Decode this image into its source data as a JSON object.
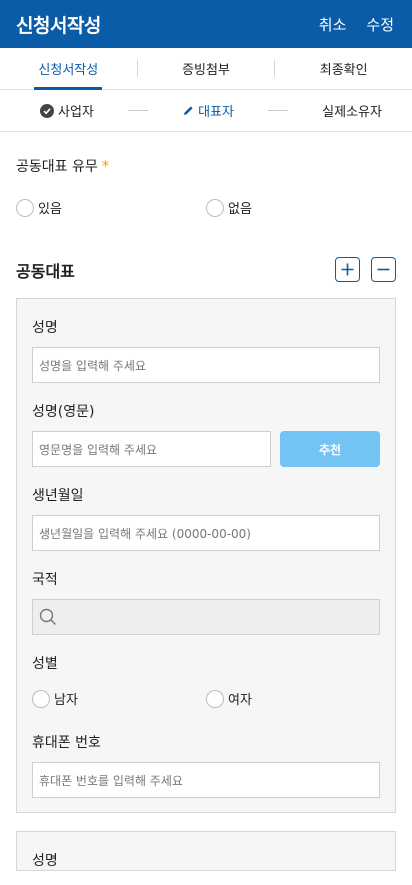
{
  "header": {
    "title": "신청서작성",
    "cancel": "취소",
    "edit": "수정"
  },
  "tabs": [
    {
      "label": "신청서작성",
      "active": true
    },
    {
      "label": "증빙첨부",
      "active": false
    },
    {
      "label": "최종확인",
      "active": false
    }
  ],
  "steps": [
    {
      "label": "사업자",
      "icon": "check-circle-icon"
    },
    {
      "label": "대표자",
      "icon": "pencil-icon"
    },
    {
      "label": "실제소유자",
      "icon": ""
    }
  ],
  "joint": {
    "question": "공동대표 유무",
    "required_mark": "*",
    "options": [
      "있음",
      "없음"
    ]
  },
  "co_rep": {
    "title": "공동대표",
    "name_label": "성명",
    "name_placeholder": "성명을 입력해 주세요",
    "eng_label": "성명(영문)",
    "eng_placeholder": "영문명을 입력해 주세요",
    "recommend": "추천",
    "birth_label": "생년월일",
    "birth_placeholder": "생년월일을 입력해 주세요 (0000-00-00)",
    "nation_label": "국적",
    "gender_label": "성별",
    "gender_options": [
      "남자",
      "여자"
    ],
    "phone_label": "휴대폰 번호",
    "phone_placeholder": "휴대폰 번호를 입력해 주세요"
  },
  "second_card": {
    "name_label": "성명"
  },
  "colors": {
    "primary": "#0a5ca8",
    "accent": "#73c3f5",
    "required": "#f5a000"
  }
}
